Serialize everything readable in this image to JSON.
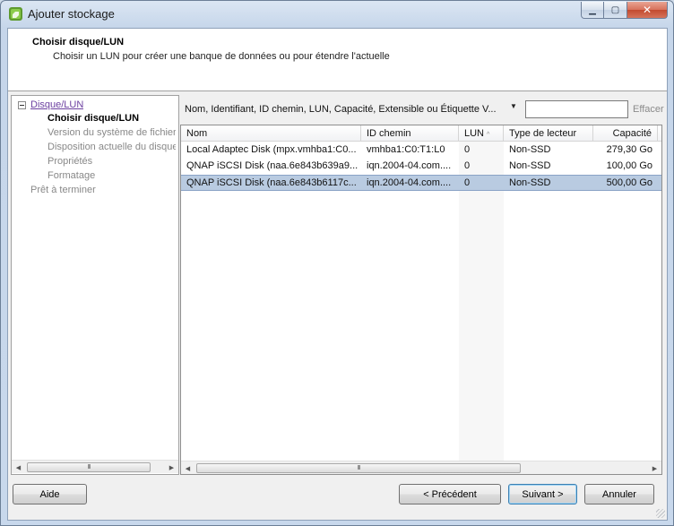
{
  "window": {
    "title": "Ajouter stockage",
    "icons": {
      "app": "storage-add-icon",
      "minimize": "minimize-icon",
      "maximize": "maximize-icon",
      "close": "close-icon"
    }
  },
  "header": {
    "title": "Choisir disque/LUN",
    "subtitle": "Choisir un LUN pour créer une banque de données ou pour étendre l'actuelle"
  },
  "nav": {
    "group": "Disque/LUN",
    "items": [
      {
        "label": "Choisir disque/LUN",
        "state": "active"
      },
      {
        "label": "Version du système de fichiers",
        "state": "pending"
      },
      {
        "label": "Disposition actuelle du disque",
        "state": "pending"
      },
      {
        "label": "Propriétés",
        "state": "pending"
      },
      {
        "label": "Formatage",
        "state": "pending"
      }
    ],
    "final": "Prêt à terminer",
    "scroll_thumb": "III"
  },
  "filter": {
    "label": "Nom, Identifiant, ID chemin, LUN, Capacité, Extensible ou Étiquette V...",
    "dropdown_glyph": "▼",
    "value": "",
    "clear_label": "Effacer"
  },
  "table": {
    "columns": [
      "Nom",
      "ID chemin",
      "LUN",
      "Type de lecteur",
      "Capacité"
    ],
    "sort_glyph": "^",
    "rows": [
      {
        "name": "Local Adaptec Disk (mpx.vmhba1:C0...",
        "path": "vmhba1:C0:T1:L0",
        "lun": "0",
        "type": "Non-SSD",
        "capacity": "279,30 Go",
        "selected": false
      },
      {
        "name": "QNAP iSCSI Disk (naa.6e843b639a9...",
        "path": "iqn.2004-04.com....",
        "lun": "0",
        "type": "Non-SSD",
        "capacity": "100,00 Go",
        "selected": false
      },
      {
        "name": "QNAP iSCSI Disk (naa.6e843b6117c...",
        "path": "iqn.2004-04.com....",
        "lun": "0",
        "type": "Non-SSD",
        "capacity": "500,00 Go",
        "selected": true
      }
    ],
    "scroll_thumb": "III"
  },
  "footer": {
    "help": "Aide",
    "back": "< Précédent",
    "next": "Suivant >",
    "cancel": "Annuler"
  }
}
